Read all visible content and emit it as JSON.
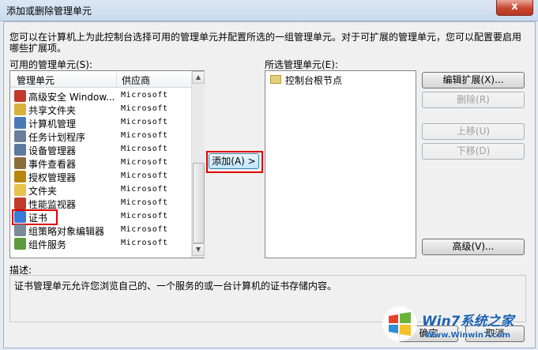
{
  "window": {
    "title": "添加或删除管理单元",
    "close_glyph": "x"
  },
  "intro": {
    "line1": "您可以在计算机上为此控制台选择可用的管理单元并配置所选的一组管理单元。对于可扩展的管理单元，您可以配置要启用",
    "line2": "哪些扩展项。"
  },
  "available": {
    "label": "可用的管理单元(S):",
    "col_snapin": "管理单元",
    "col_vendor": "供应商",
    "items": [
      {
        "name": "高级安全 Window...",
        "vendor": "Microsoft",
        "icon": "firewall-icon",
        "color": "#c0392b"
      },
      {
        "name": "共享文件夹",
        "vendor": "Microsoft",
        "icon": "shared-folder-icon",
        "color": "#d9b23a"
      },
      {
        "name": "计算机管理",
        "vendor": "Microsoft",
        "icon": "computer-management-icon",
        "color": "#4a7ab8"
      },
      {
        "name": "任务计划程序",
        "vendor": "Microsoft",
        "icon": "clock-icon",
        "color": "#6a7f99"
      },
      {
        "name": "设备管理器",
        "vendor": "Microsoft",
        "icon": "device-manager-icon",
        "color": "#5d7aa0"
      },
      {
        "name": "事件查看器",
        "vendor": "Microsoft",
        "icon": "event-viewer-icon",
        "color": "#8a6d3b"
      },
      {
        "name": "授权管理器",
        "vendor": "Microsoft",
        "icon": "authorization-icon",
        "color": "#b8860b"
      },
      {
        "name": "文件夹",
        "vendor": "Microsoft",
        "icon": "folder-icon",
        "color": "#e6c34a"
      },
      {
        "name": "性能监视器",
        "vendor": "Microsoft",
        "icon": "performance-icon",
        "color": "#c0392b"
      },
      {
        "name": "证书",
        "vendor": "Microsoft",
        "icon": "certificate-icon",
        "color": "#3a7bd5"
      },
      {
        "name": "组策略对象编辑器",
        "vendor": "Microsoft",
        "icon": "group-policy-icon",
        "color": "#7a8a99"
      },
      {
        "name": "组件服务",
        "vendor": "Microsoft",
        "icon": "component-services-icon",
        "color": "#5a9a3a"
      }
    ]
  },
  "add_button": "添加(A) >",
  "selected": {
    "label": "所选管理单元(E):",
    "items": [
      {
        "name": "控制台根节点",
        "icon": "folder-icon"
      }
    ]
  },
  "buttons": {
    "edit_ext": "编辑扩展(X)...",
    "remove": "删除(R)",
    "move_up": "上移(U)",
    "move_down": "下移(D)",
    "advanced": "高级(V)...",
    "ok": "确定",
    "cancel": "取消"
  },
  "description": {
    "label": "描述:",
    "text": "证书管理单元允许您浏览自己的、一个服务的或一台计算机的证书存储内容。"
  },
  "watermark": {
    "logo_text": "Win7系统之家",
    "url": "Www.Winwin7.com"
  }
}
